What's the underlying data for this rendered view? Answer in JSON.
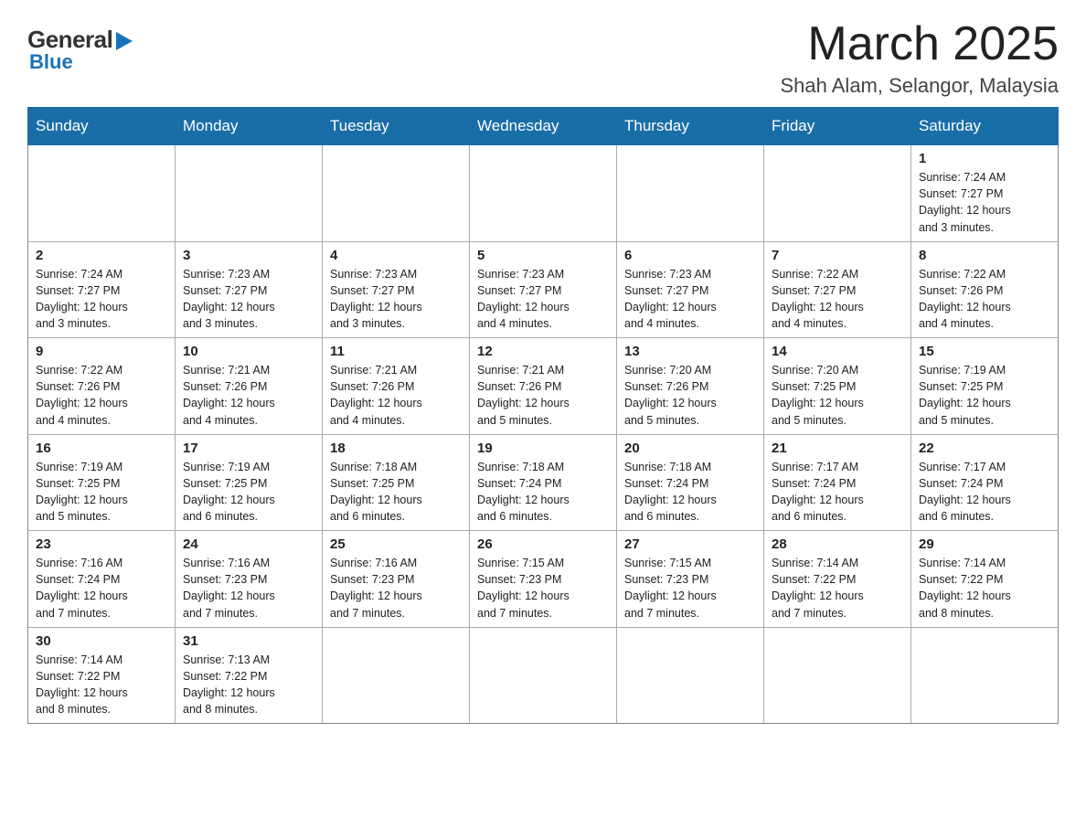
{
  "header": {
    "logo_general": "General",
    "logo_blue": "Blue",
    "title": "March 2025",
    "subtitle": "Shah Alam, Selangor, Malaysia"
  },
  "weekdays": [
    "Sunday",
    "Monday",
    "Tuesday",
    "Wednesday",
    "Thursday",
    "Friday",
    "Saturday"
  ],
  "weeks": [
    [
      {
        "day": "",
        "info": ""
      },
      {
        "day": "",
        "info": ""
      },
      {
        "day": "",
        "info": ""
      },
      {
        "day": "",
        "info": ""
      },
      {
        "day": "",
        "info": ""
      },
      {
        "day": "",
        "info": ""
      },
      {
        "day": "1",
        "info": "Sunrise: 7:24 AM\nSunset: 7:27 PM\nDaylight: 12 hours\nand 3 minutes."
      }
    ],
    [
      {
        "day": "2",
        "info": "Sunrise: 7:24 AM\nSunset: 7:27 PM\nDaylight: 12 hours\nand 3 minutes."
      },
      {
        "day": "3",
        "info": "Sunrise: 7:23 AM\nSunset: 7:27 PM\nDaylight: 12 hours\nand 3 minutes."
      },
      {
        "day": "4",
        "info": "Sunrise: 7:23 AM\nSunset: 7:27 PM\nDaylight: 12 hours\nand 3 minutes."
      },
      {
        "day": "5",
        "info": "Sunrise: 7:23 AM\nSunset: 7:27 PM\nDaylight: 12 hours\nand 4 minutes."
      },
      {
        "day": "6",
        "info": "Sunrise: 7:23 AM\nSunset: 7:27 PM\nDaylight: 12 hours\nand 4 minutes."
      },
      {
        "day": "7",
        "info": "Sunrise: 7:22 AM\nSunset: 7:27 PM\nDaylight: 12 hours\nand 4 minutes."
      },
      {
        "day": "8",
        "info": "Sunrise: 7:22 AM\nSunset: 7:26 PM\nDaylight: 12 hours\nand 4 minutes."
      }
    ],
    [
      {
        "day": "9",
        "info": "Sunrise: 7:22 AM\nSunset: 7:26 PM\nDaylight: 12 hours\nand 4 minutes."
      },
      {
        "day": "10",
        "info": "Sunrise: 7:21 AM\nSunset: 7:26 PM\nDaylight: 12 hours\nand 4 minutes."
      },
      {
        "day": "11",
        "info": "Sunrise: 7:21 AM\nSunset: 7:26 PM\nDaylight: 12 hours\nand 4 minutes."
      },
      {
        "day": "12",
        "info": "Sunrise: 7:21 AM\nSunset: 7:26 PM\nDaylight: 12 hours\nand 5 minutes."
      },
      {
        "day": "13",
        "info": "Sunrise: 7:20 AM\nSunset: 7:26 PM\nDaylight: 12 hours\nand 5 minutes."
      },
      {
        "day": "14",
        "info": "Sunrise: 7:20 AM\nSunset: 7:25 PM\nDaylight: 12 hours\nand 5 minutes."
      },
      {
        "day": "15",
        "info": "Sunrise: 7:19 AM\nSunset: 7:25 PM\nDaylight: 12 hours\nand 5 minutes."
      }
    ],
    [
      {
        "day": "16",
        "info": "Sunrise: 7:19 AM\nSunset: 7:25 PM\nDaylight: 12 hours\nand 5 minutes."
      },
      {
        "day": "17",
        "info": "Sunrise: 7:19 AM\nSunset: 7:25 PM\nDaylight: 12 hours\nand 6 minutes."
      },
      {
        "day": "18",
        "info": "Sunrise: 7:18 AM\nSunset: 7:25 PM\nDaylight: 12 hours\nand 6 minutes."
      },
      {
        "day": "19",
        "info": "Sunrise: 7:18 AM\nSunset: 7:24 PM\nDaylight: 12 hours\nand 6 minutes."
      },
      {
        "day": "20",
        "info": "Sunrise: 7:18 AM\nSunset: 7:24 PM\nDaylight: 12 hours\nand 6 minutes."
      },
      {
        "day": "21",
        "info": "Sunrise: 7:17 AM\nSunset: 7:24 PM\nDaylight: 12 hours\nand 6 minutes."
      },
      {
        "day": "22",
        "info": "Sunrise: 7:17 AM\nSunset: 7:24 PM\nDaylight: 12 hours\nand 6 minutes."
      }
    ],
    [
      {
        "day": "23",
        "info": "Sunrise: 7:16 AM\nSunset: 7:24 PM\nDaylight: 12 hours\nand 7 minutes."
      },
      {
        "day": "24",
        "info": "Sunrise: 7:16 AM\nSunset: 7:23 PM\nDaylight: 12 hours\nand 7 minutes."
      },
      {
        "day": "25",
        "info": "Sunrise: 7:16 AM\nSunset: 7:23 PM\nDaylight: 12 hours\nand 7 minutes."
      },
      {
        "day": "26",
        "info": "Sunrise: 7:15 AM\nSunset: 7:23 PM\nDaylight: 12 hours\nand 7 minutes."
      },
      {
        "day": "27",
        "info": "Sunrise: 7:15 AM\nSunset: 7:23 PM\nDaylight: 12 hours\nand 7 minutes."
      },
      {
        "day": "28",
        "info": "Sunrise: 7:14 AM\nSunset: 7:22 PM\nDaylight: 12 hours\nand 7 minutes."
      },
      {
        "day": "29",
        "info": "Sunrise: 7:14 AM\nSunset: 7:22 PM\nDaylight: 12 hours\nand 8 minutes."
      }
    ],
    [
      {
        "day": "30",
        "info": "Sunrise: 7:14 AM\nSunset: 7:22 PM\nDaylight: 12 hours\nand 8 minutes."
      },
      {
        "day": "31",
        "info": "Sunrise: 7:13 AM\nSunset: 7:22 PM\nDaylight: 12 hours\nand 8 minutes."
      },
      {
        "day": "",
        "info": ""
      },
      {
        "day": "",
        "info": ""
      },
      {
        "day": "",
        "info": ""
      },
      {
        "day": "",
        "info": ""
      },
      {
        "day": "",
        "info": ""
      }
    ]
  ]
}
